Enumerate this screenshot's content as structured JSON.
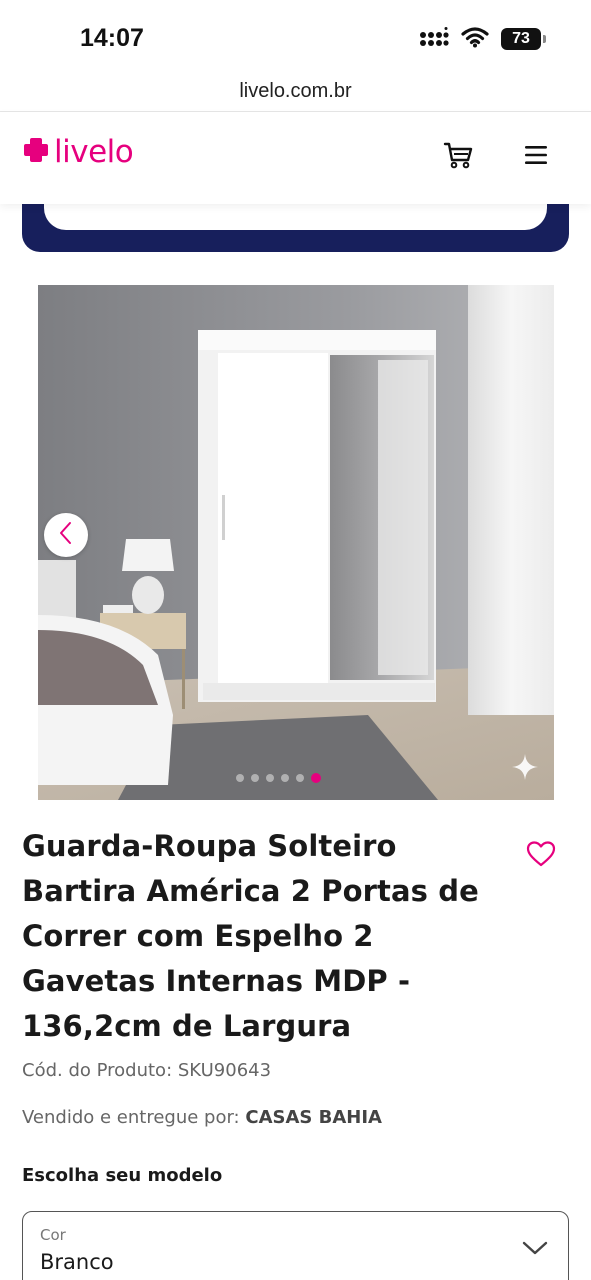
{
  "status_bar": {
    "time": "14:07",
    "battery": "73"
  },
  "browser": {
    "url": "livelo.com.br"
  },
  "header": {
    "logo_text": "livelo"
  },
  "product": {
    "title": "Guarda-Roupa Solteiro Bartira América 2 Portas de Correr com Espelho 2 Gavetas Internas MDP - 136,2cm de Largura",
    "sku_label": "Cód. do Produto:",
    "sku": "SKU90643",
    "seller_label": "Vendido e entregue por:",
    "seller": "CASAS BAHIA",
    "carousel": {
      "total_images": 6,
      "active_index": 5
    }
  },
  "model_selector": {
    "heading": "Escolha seu modelo",
    "field_label": "Cor",
    "selected_value": "Branco"
  },
  "colors": {
    "brand_pink": "#e6007e",
    "navy": "#171f5c"
  },
  "icons": [
    "wifi-icon",
    "signal-icon",
    "battery-icon",
    "cart-icon",
    "menu-icon",
    "chevron-left-icon",
    "sparkle-icon",
    "heart-icon",
    "chevron-down-icon"
  ]
}
